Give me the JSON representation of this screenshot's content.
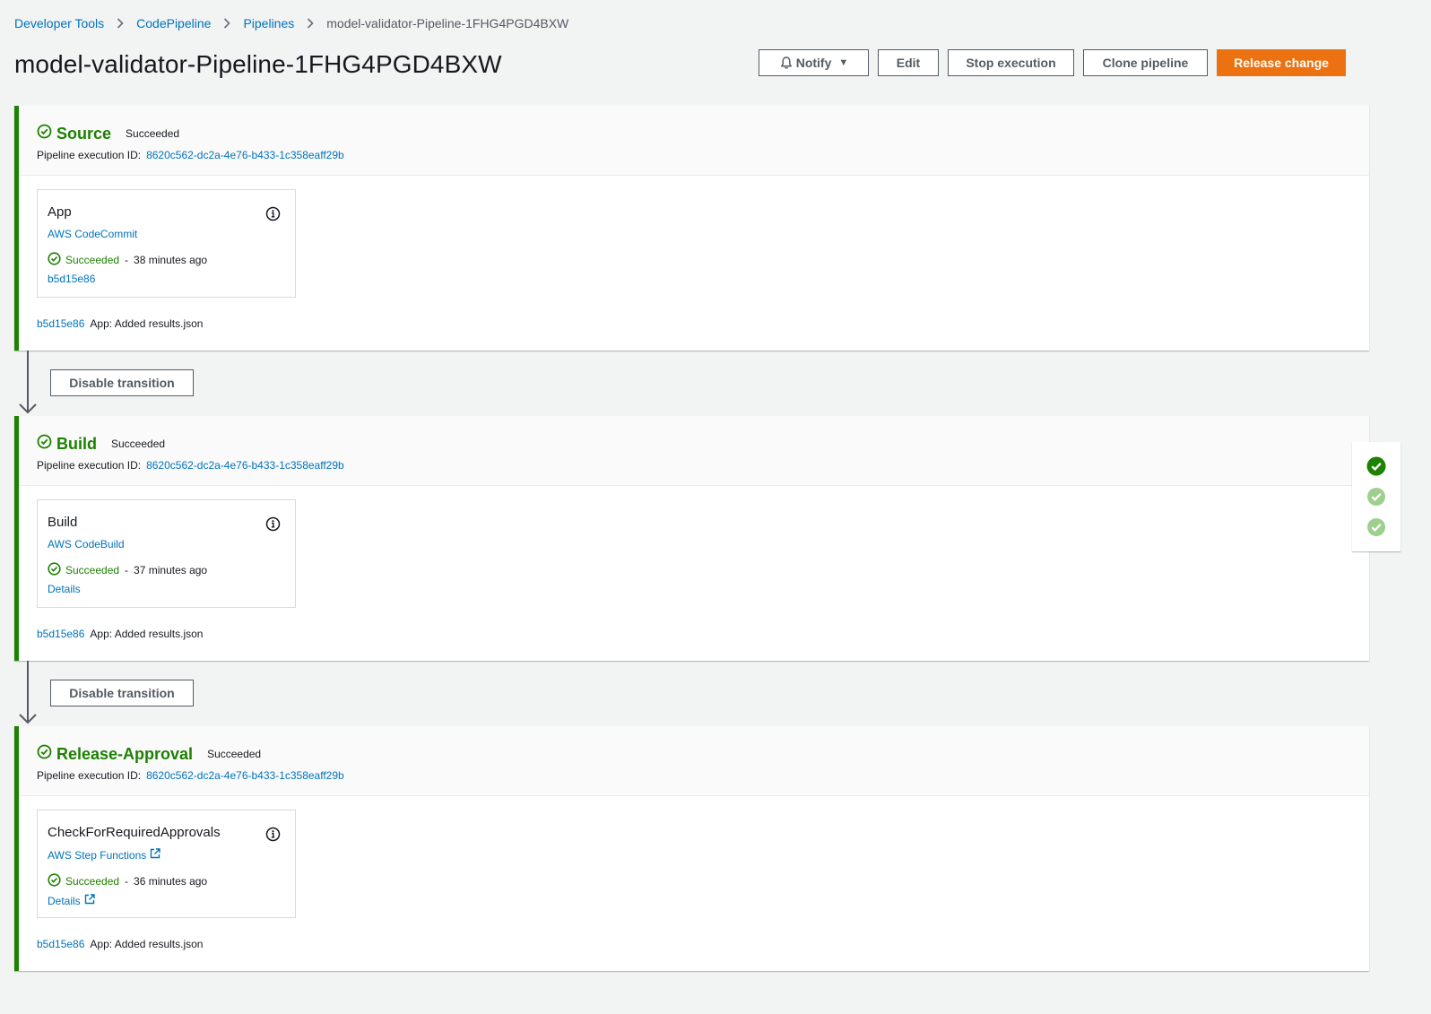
{
  "breadcrumb": {
    "items": [
      "Developer Tools",
      "CodePipeline",
      "Pipelines"
    ],
    "current": "model-validator-Pipeline-1FHG4PGD4BXW"
  },
  "page": {
    "title": "model-validator-Pipeline-1FHG4PGD4BXW"
  },
  "toolbar": {
    "notify_label": "Notify",
    "edit_label": "Edit",
    "stop_label": "Stop execution",
    "clone_label": "Clone pipeline",
    "release_label": "Release change"
  },
  "common": {
    "exec_label": "Pipeline execution ID:",
    "exec_id": "8620c562-dc2a-4e76-b433-1c358eaff29b",
    "commit_id": "b5d15e86",
    "commit_msg": "App: Added results.json",
    "transition_label": "Disable transition",
    "dash": "-"
  },
  "stages": [
    {
      "name": "Source",
      "status": "Succeeded",
      "action": {
        "name": "App",
        "provider": "AWS CodeCommit",
        "status": "Succeeded",
        "time": "38 minutes ago",
        "link": "b5d15e86"
      }
    },
    {
      "name": "Build",
      "status": "Succeeded",
      "action": {
        "name": "Build",
        "provider": "AWS CodeBuild",
        "status": "Succeeded",
        "time": "37 minutes ago",
        "link": "Details"
      }
    },
    {
      "name": "Release-Approval",
      "status": "Succeeded",
      "action": {
        "name": "CheckForRequiredApprovals",
        "provider": "AWS Step Functions",
        "status": "Succeeded",
        "time": "36 minutes ago",
        "link": "Details"
      }
    }
  ],
  "colors": {
    "success": "#1d8102",
    "link": "#0073bb",
    "primary": "#ec7211",
    "background": "#f2f3f3"
  }
}
